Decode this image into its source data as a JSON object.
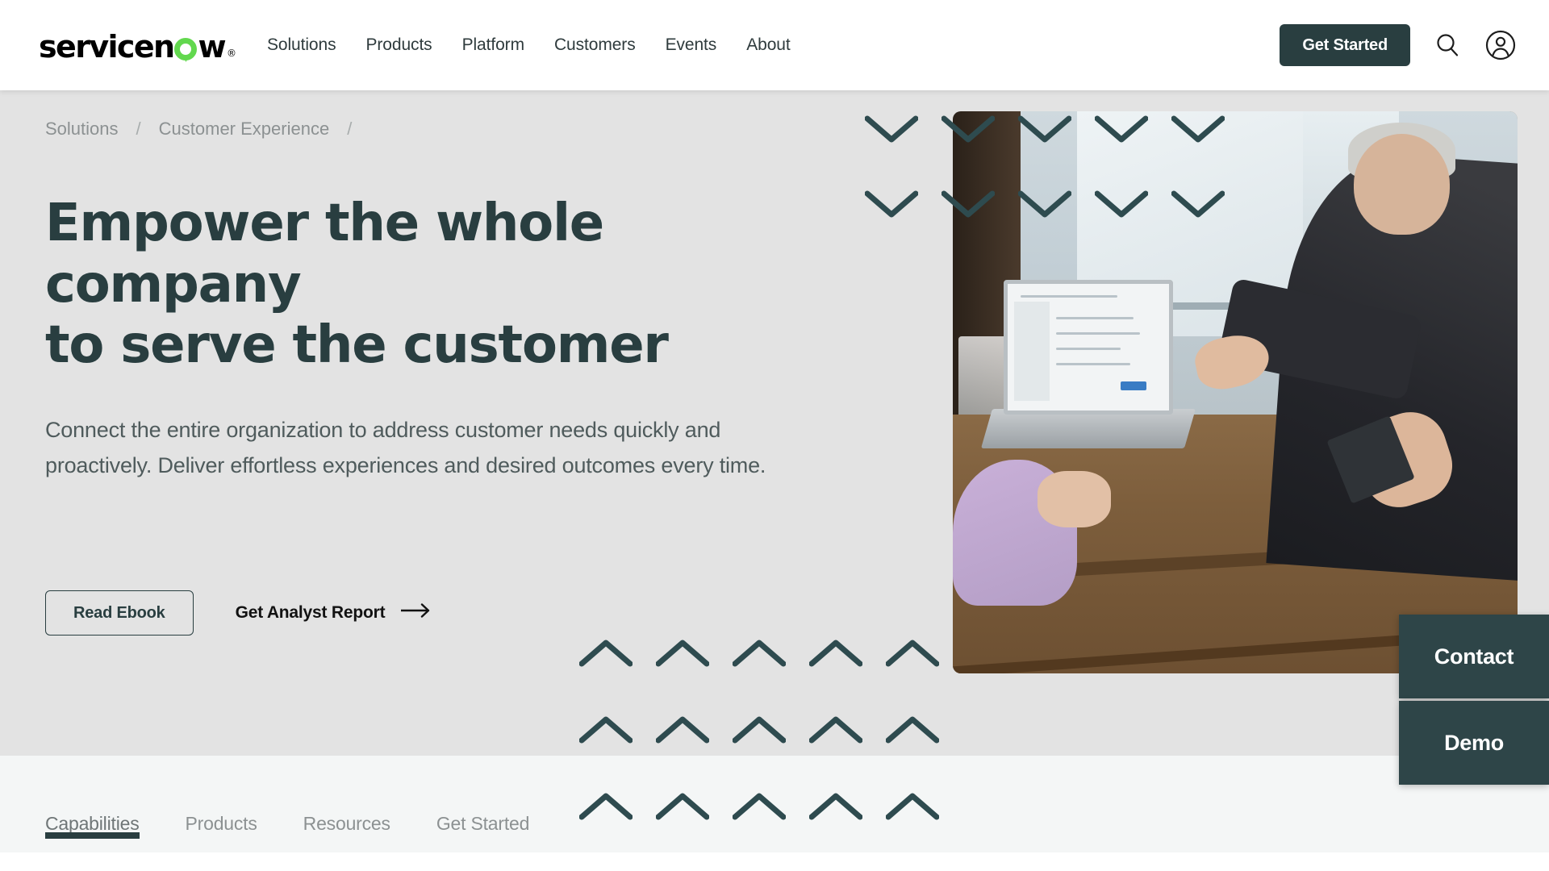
{
  "brand": {
    "logo_text_before": "servicen",
    "logo_text_after": "w",
    "logo_registered": "®",
    "green": "#62d84e",
    "dark": "#293e40"
  },
  "header": {
    "nav": [
      {
        "label": "Solutions"
      },
      {
        "label": "Products"
      },
      {
        "label": "Platform"
      },
      {
        "label": "Customers"
      },
      {
        "label": "Events"
      },
      {
        "label": "About"
      }
    ],
    "get_started_label": "Get Started",
    "search_icon": "search-icon",
    "account_icon": "account-icon"
  },
  "hero": {
    "breadcrumb": [
      {
        "label": "Solutions"
      },
      {
        "label": "Customer Experience"
      }
    ],
    "breadcrumb_separator": "/",
    "title_line1": "Empower the whole company",
    "title_line2": "to serve the customer",
    "body": "Connect the entire organization to address customer needs quickly and proactively. Deliver effortless experiences and desired outcomes every time.",
    "cta_primary": "Read Ebook",
    "cta_secondary": "Get Analyst Report",
    "cta_secondary_icon": "arrow-right-icon",
    "background_color": "#e3e3e3"
  },
  "tabbar": {
    "items": [
      {
        "label": "Capabilities",
        "active": true
      },
      {
        "label": "Products",
        "active": false
      },
      {
        "label": "Resources",
        "active": false
      },
      {
        "label": "Get Started",
        "active": false
      }
    ],
    "background_color": "#f4f6f6",
    "active_underline_color": "#293e40"
  },
  "side_tabs": [
    {
      "label": "Contact"
    },
    {
      "label": "Demo"
    }
  ],
  "decor": {
    "chevron_color": "#2e4b4f",
    "down_icon": "chevron-down-icon",
    "up_icon": "chevron-up-icon"
  }
}
